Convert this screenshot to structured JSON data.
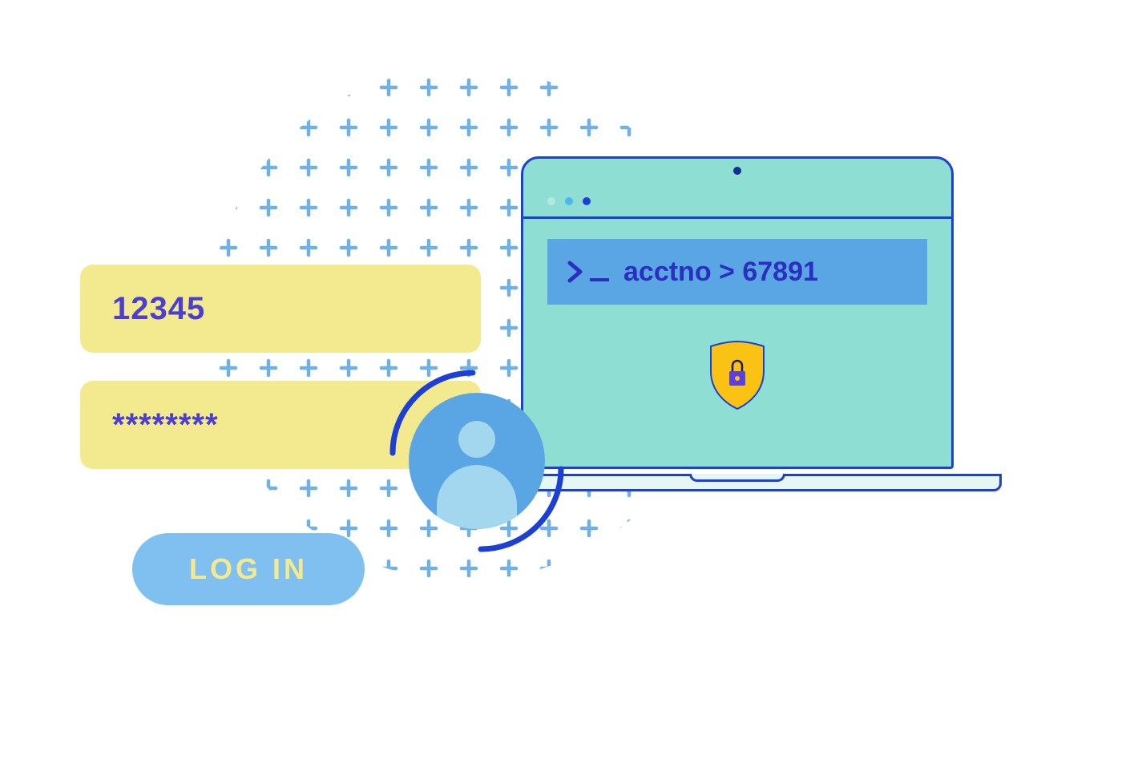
{
  "login": {
    "username_value": "12345",
    "password_masked": "********",
    "button_label": "LOG IN"
  },
  "terminal": {
    "command_text": "acctno > 67891"
  },
  "icons": {
    "prompt": "prompt-icon",
    "shield": "shield-lock-icon",
    "avatar": "user-avatar-icon"
  },
  "colors": {
    "field_bg": "#f3ea8f",
    "primary_text": "#4b3fd1",
    "button_bg": "#7fc0f0",
    "button_text": "#f3ea8f",
    "laptop_border": "#1c3fd6",
    "screen_bg": "#8fded3",
    "terminal_bg": "#5aa6e4",
    "terminal_text": "#2a2fbf",
    "avatar_bg": "#5aa6e4",
    "avatar_fg": "#a3d7ef",
    "shield": "#fac213"
  }
}
